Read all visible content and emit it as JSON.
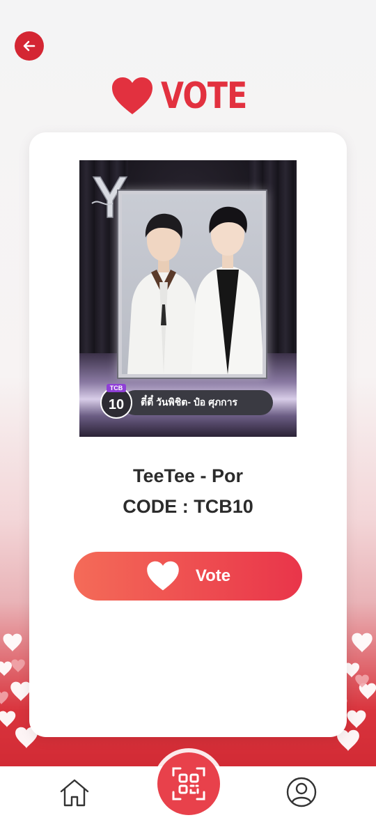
{
  "header": {
    "title": "VOTE",
    "back_icon": "arrow-left-icon"
  },
  "candidate": {
    "photo_badge_label": "TCB",
    "photo_badge_number": "10",
    "photo_caption": "ตี๋ตี๋ วันพิชิต- ป๋อ ศุภการ",
    "name": "TeeTee - Por",
    "code": "CODE : TCB10"
  },
  "actions": {
    "vote_label": "Vote"
  },
  "bottom_nav": {
    "home_icon": "home-icon",
    "scan_icon": "qr-scan-icon",
    "profile_icon": "user-profile-icon"
  },
  "colors": {
    "accent": "#e2313f",
    "vote_gradient_start": "#f46b58",
    "vote_gradient_end": "#e9354a",
    "badge_purple": "#8f3fd6"
  }
}
